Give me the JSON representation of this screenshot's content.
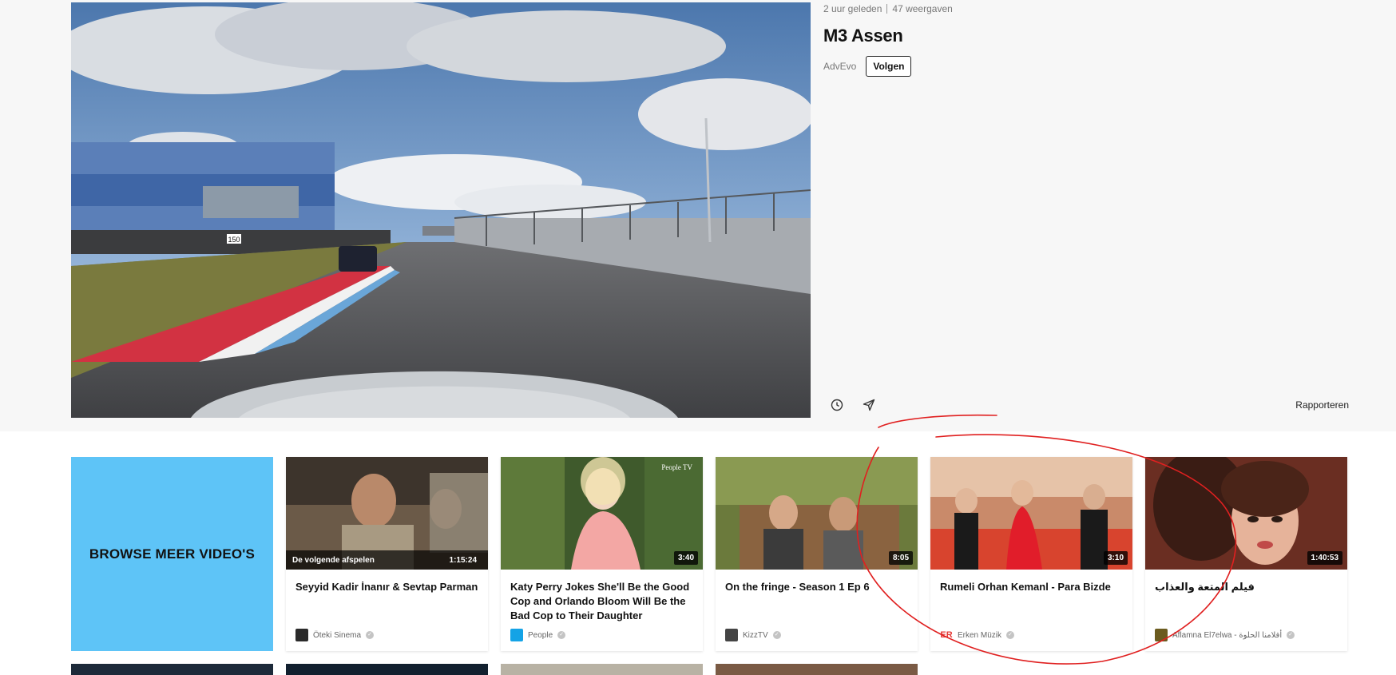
{
  "video": {
    "meta_time": "2 uur geleden",
    "meta_views": "47 weergaven",
    "title": "M3 Assen",
    "channel": "AdvEvo",
    "follow_label": "Volgen",
    "report_label": "Rapporteren",
    "sign_number": "150",
    "icons": [
      "clock-icon",
      "share-icon"
    ]
  },
  "browse": {
    "label": "BROWSE MEER VIDEO'S"
  },
  "cards": [
    {
      "title": "Seyyid    Kadir İnanır & Sevtap Parman",
      "channel": "Öteki Sinema",
      "upnext": "De volgende afspelen",
      "duration": "1:15:24"
    },
    {
      "title": "Katy Perry Jokes She'll Be the Good Cop and Orlando Bloom Will Be the Bad Cop to Their Daughter",
      "channel": "People",
      "duration": "3:40",
      "watermark": "People TV"
    },
    {
      "title": "On the fringe - Season 1 Ep 6",
      "channel": "KizzTV",
      "duration": "8:05"
    },
    {
      "title": "Rumeli Orhan Kemanl - Para Bizde",
      "channel": "Erken Müzik",
      "duration": "3:10"
    },
    {
      "title": "فيلم المتعة والعذاب",
      "channel": "Aflamna El7elwa - أفلامنا الحلوة",
      "duration": "1:40:53"
    }
  ],
  "colors": {
    "accent": "#5ec4f7",
    "annotation": "#e02020",
    "people_logo": "#14a3e6",
    "erken_logo": "#e53935"
  }
}
